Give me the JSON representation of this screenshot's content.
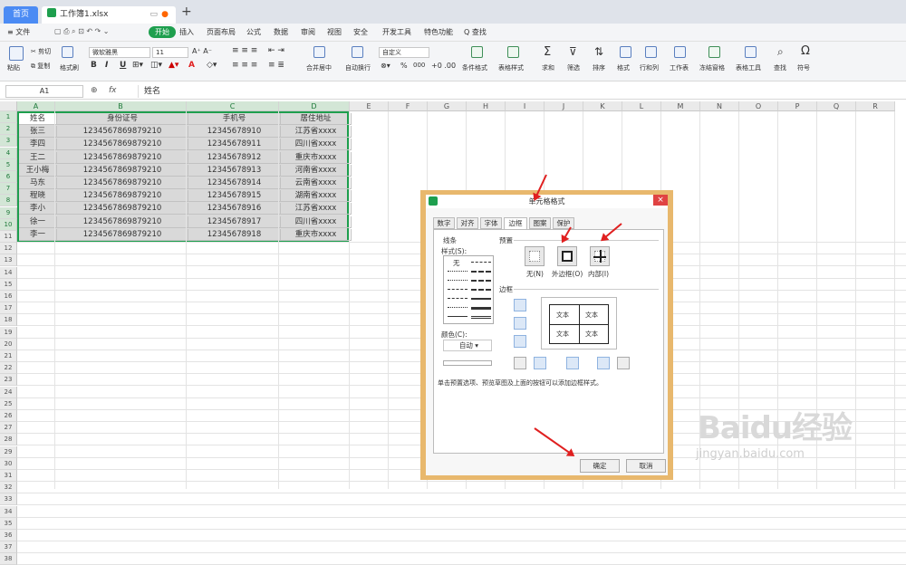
{
  "tabs": {
    "home": "首页",
    "file": "工作簿1.xlsx",
    "add": "+"
  },
  "menu": {
    "file": "≡ 文件",
    "items": [
      "开始",
      "插入",
      "页面布局",
      "公式",
      "数据",
      "审阅",
      "视图",
      "安全",
      "开发工具",
      "特色功能",
      "Q 查找"
    ]
  },
  "ribbon": {
    "paste": "粘贴",
    "cut": "剪切",
    "copy": "复制",
    "format_painter": "格式刷",
    "font": "微软雅黑",
    "size": "11",
    "bold": "B",
    "italic": "I",
    "underline": "U",
    "font_color": "A",
    "merge": "合并居中",
    "wrap": "自动换行",
    "number_format": "自定义",
    "cond_format": "条件格式",
    "table_style": "表格样式",
    "sum": "求和",
    "filter": "筛选",
    "sort": "排序",
    "format": "格式",
    "rowcol": "行和列",
    "sheet": "工作表",
    "freeze": "冻结窗格",
    "table_tools": "表格工具",
    "find": "查找",
    "symbol": "符号",
    "percent": "%",
    "thousands": "000"
  },
  "formula": {
    "cell": "A1",
    "fx": "fx",
    "value": "姓名"
  },
  "columns": [
    "A",
    "B",
    "C",
    "D",
    "E",
    "F",
    "G",
    "H",
    "I",
    "J",
    "K",
    "L",
    "M",
    "N",
    "O",
    "P",
    "Q",
    "R"
  ],
  "rows": [
    "1",
    "2",
    "3",
    "4",
    "5",
    "6",
    "7",
    "8",
    "9",
    "10",
    "11",
    "12",
    "13",
    "14",
    "15",
    "16",
    "17",
    "18",
    "19",
    "20",
    "21",
    "22",
    "23",
    "24",
    "25",
    "26",
    "27",
    "28",
    "29",
    "30",
    "31",
    "32",
    "33",
    "34",
    "35",
    "36",
    "37",
    "38"
  ],
  "table": [
    [
      "姓名",
      "身份证号",
      "手机号",
      "居住地址"
    ],
    [
      "张三",
      "1234567869879210",
      "12345678910",
      "江苏省xxxx"
    ],
    [
      "李四",
      "1234567869879210",
      "12345678911",
      "四川省xxxx"
    ],
    [
      "王二",
      "1234567869879210",
      "12345678912",
      "重庆市xxxx"
    ],
    [
      "王小梅",
      "1234567869879210",
      "12345678913",
      "河南省xxxx"
    ],
    [
      "马东",
      "1234567869879210",
      "12345678914",
      "云南省xxxx"
    ],
    [
      "程晓",
      "1234567869879210",
      "12345678915",
      "湖南省xxxx"
    ],
    [
      "李小",
      "1234567869879210",
      "12345678916",
      "江苏省xxxx"
    ],
    [
      "徐一",
      "1234567869879210",
      "12345678917",
      "四川省xxxx"
    ],
    [
      "李一",
      "1234567869879210",
      "12345678918",
      "重庆市xxxx"
    ]
  ],
  "dialog": {
    "title": "单元格格式",
    "close": "×",
    "tabs": [
      "数字",
      "对齐",
      "字体",
      "边框",
      "图案",
      "保护"
    ],
    "line_section": "线条",
    "style_label": "样式(S):",
    "none": "无",
    "color_label": "颜色(C):",
    "color_value": "自动",
    "preset_section": "预置",
    "presets": [
      "无(N)",
      "外边框(O)",
      "内部(I)"
    ],
    "border_section": "边框",
    "preview_text": "文本",
    "hint": "单击预置选项、预览草图及上面的按钮可以添加边框样式。",
    "ok": "确定",
    "cancel": "取消"
  },
  "watermark": {
    "brand": "Baidu经验",
    "url": "jingyan.baidu.com"
  }
}
